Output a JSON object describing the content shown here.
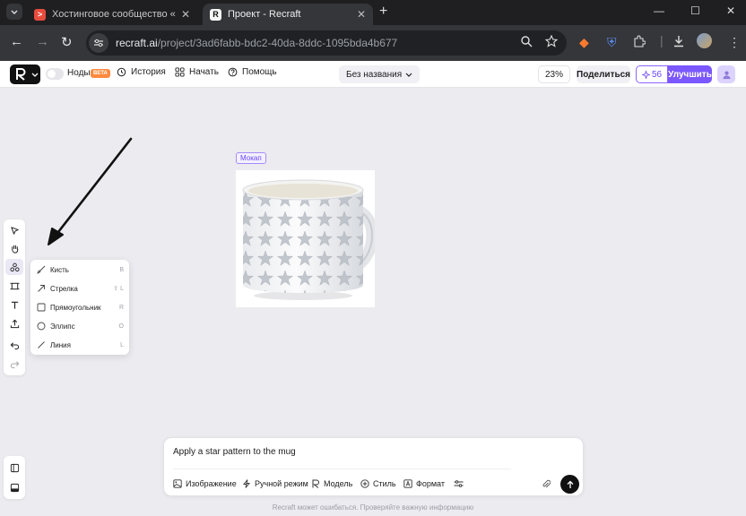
{
  "browser": {
    "tabs": [
      {
        "title": "Хостинговое сообщество «Tim",
        "active": false,
        "favicon_color": "#e84c3d"
      },
      {
        "title": "Проект - Recraft",
        "active": true,
        "favicon_color": "#111111"
      }
    ],
    "url_host": "recraft.ai",
    "url_path": "/project/3ad6fabb-bdc2-40da-8ddc-1095bda4b677"
  },
  "header": {
    "nodes_label": "Ноды",
    "beta_badge": "BETA",
    "history_label": "История",
    "start_label": "Начать",
    "help_label": "Помощь",
    "project_title": "Без названия",
    "zoom": "23%",
    "share_label": "Поделиться",
    "credits": "56",
    "upgrade_label": "Улучшить"
  },
  "canvas": {
    "frame_label": "Мокап"
  },
  "tool_menu": {
    "items": [
      {
        "label": "Кисть",
        "key": "B",
        "icon": "brush-icon"
      },
      {
        "label": "Стрелка",
        "key": "⇧ L",
        "icon": "arrow-icon"
      },
      {
        "label": "Прямоугольник",
        "key": "R",
        "icon": "rectangle-icon"
      },
      {
        "label": "Эллипс",
        "key": "O",
        "icon": "ellipse-icon"
      },
      {
        "label": "Линия",
        "key": "L",
        "icon": "line-icon"
      }
    ]
  },
  "prompt": {
    "text": "Apply a star pattern to the mug",
    "tools": {
      "image": "Изображение",
      "manual": "Ручной режим",
      "model": "Модель",
      "style": "Стиль",
      "format": "Формат"
    }
  },
  "footnote": "Recraft может ошибаться. Проверяйте важную информацию",
  "colors": {
    "accent": "#7b57ff",
    "canvas_bg": "#ecebef",
    "annotation_arrow": "#111111"
  }
}
